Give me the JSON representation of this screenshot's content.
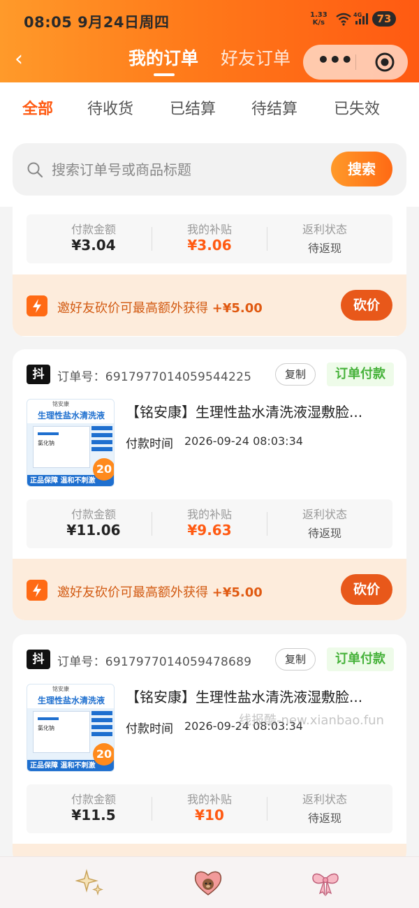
{
  "status": {
    "time": "08:05",
    "date": "9月24日周四",
    "speed": "1.33",
    "speed_unit": "K/s",
    "battery": "73"
  },
  "nav": {
    "back_icon": "chevron-left-icon",
    "tab_active": "我的订单",
    "tab_inactive": "好友订单",
    "more_icon": "more-dots-icon",
    "close_icon": "target-icon"
  },
  "filters": [
    "全部",
    "待收货",
    "已结算",
    "待结算",
    "已失效"
  ],
  "search": {
    "placeholder": "搜索订单号或商品标题",
    "button": "搜索"
  },
  "partial_order": {
    "stats": {
      "paid_label": "付款金额",
      "paid_value": "¥3.04",
      "subsidy_label": "我的补贴",
      "subsidy_value": "¥3.06",
      "rebate_label": "返利状态",
      "rebate_value": "待返现"
    },
    "promo": {
      "text": "邀好友砍价可最高额外获得",
      "amount": "+¥5.00",
      "button": "砍价"
    }
  },
  "orders": [
    {
      "platform": "抖",
      "order_no": "订单号：6917977014059544225",
      "copy": "复制",
      "status": "订单付款",
      "title": "【铭安康】生理性盐水清洗液湿敷脸...",
      "time_label": "付款时间",
      "time": "2026-09-24 08:03:34",
      "thumb": {
        "brand": "铭安康",
        "title": "生理性盐水清洗液",
        "box_text": "氯化钠",
        "badge": "20",
        "footer": "正品保障 温和不刺激"
      },
      "stats": {
        "paid_label": "付款金额",
        "paid_value": "¥11.06",
        "subsidy_label": "我的补贴",
        "subsidy_value": "¥9.63",
        "rebate_label": "返利状态",
        "rebate_value": "待返现"
      },
      "promo": {
        "text": "邀好友砍价可最高额外获得",
        "amount": "+¥5.00",
        "button": "砍价"
      }
    },
    {
      "platform": "抖",
      "order_no": "订单号：6917977014059478689",
      "copy": "复制",
      "status": "订单付款",
      "title": "【铭安康】生理性盐水清洗液湿敷脸...",
      "time_label": "付款时间",
      "time": "2026-09-24 08:03:34",
      "thumb": {
        "brand": "铭安康",
        "title": "生理性盐水清洗液",
        "box_text": "氯化钠",
        "badge": "20",
        "footer": "正品保障 温和不刺激"
      },
      "stats": {
        "paid_label": "付款金额",
        "paid_value": "¥11.5",
        "subsidy_label": "我的补贴",
        "subsidy_value": "¥10",
        "rebate_label": "返利状态",
        "rebate_value": "待返现"
      }
    }
  ],
  "watermark": "线报酷-new.xianbao.fun",
  "bottom_tabs": [
    {
      "icon": "sparkle-icon"
    },
    {
      "icon": "heart-bear-icon"
    },
    {
      "icon": "bow-icon"
    }
  ],
  "colors": {
    "accent": "#ff5a12",
    "header_start": "#ff9a2a",
    "header_end": "#ff5a12",
    "paid_green": "#46b23a",
    "promo_bg": "#fdecdc"
  }
}
